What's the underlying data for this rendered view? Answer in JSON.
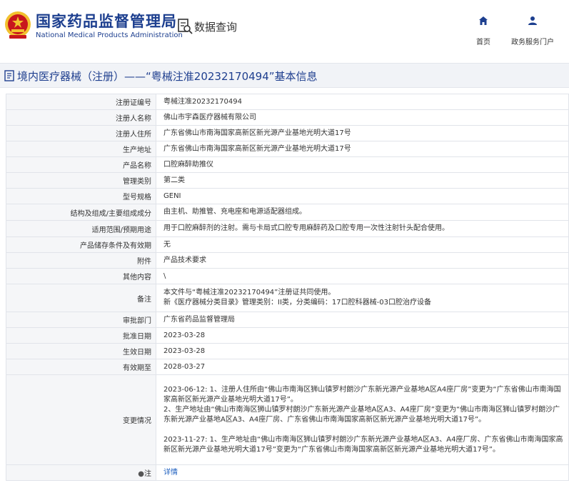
{
  "header": {
    "agency_name_cn": "国家药品监督管理局",
    "agency_name_en": "National Medical Products Administration",
    "database_title": "数据查询",
    "nav": [
      {
        "label": "首页",
        "icon": "home-icon"
      },
      {
        "label": "政务服务门户",
        "icon": "user-icon"
      }
    ]
  },
  "page": {
    "title": "境内医疗器械（注册）——“粤械注准20232170494”基本信息"
  },
  "fields": [
    {
      "label": "注册证编号",
      "value": "粤械注准20232170494"
    },
    {
      "label": "注册人名称",
      "value": "佛山市宇森医疗器械有限公司"
    },
    {
      "label": "注册人住所",
      "value": "广东省佛山市南海国家高新区新光源产业基地光明大道17号"
    },
    {
      "label": "生产地址",
      "value": "广东省佛山市南海国家高新区新光源产业基地光明大道17号"
    },
    {
      "label": "产品名称",
      "value": "口腔麻醉助推仪"
    },
    {
      "label": "管理类别",
      "value": "第二类"
    },
    {
      "label": "型号规格",
      "value": "GENI"
    },
    {
      "label": "结构及组成/主要组成成分",
      "value": "由主机、助推管、充电座和电源适配器组成。"
    },
    {
      "label": "适用范围/预期用途",
      "value": "用于口腔麻醉剂的注射。需与卡局式口腔专用麻醉药及口腔专用一次性注射针头配合使用。"
    },
    {
      "label": "产品储存条件及有效期",
      "value": "无"
    },
    {
      "label": "附件",
      "value": "产品技术要求"
    },
    {
      "label": "其他内容",
      "value": "\\"
    },
    {
      "label": "备注",
      "lines": [
        "本文件与“粤械注准20232170494”注册证共同使用。",
        "新《医疗器械分类目录》管理类别：II类，分类编码：17口腔科器械-03口腔治疗设备"
      ]
    },
    {
      "label": "审批部门",
      "value": "广东省药品监督管理局"
    },
    {
      "label": "批准日期",
      "value": "2023-03-28"
    },
    {
      "label": "生效日期",
      "value": "2023-03-28"
    },
    {
      "label": "有效期至",
      "value": "2028-03-27"
    },
    {
      "label": "变更情况",
      "lines": [
        "2023-06-12: 1、注册人住所由“佛山市南海区狮山镇罗村朗沙广东新光源产业基地A区A4座厂房”变更为“广东省佛山市南海国家高新区新光源产业基地光明大道17号”。",
        "2、生产地址由“佛山市南海区狮山镇罗村朗沙广东新光源产业基地A区A3、A4座厂房”变更为“佛山市南海区狮山镇罗村朗沙广东新光源产业基地A区A3、A4座厂房、广东省佛山市南海国家高新区新光源产业基地光明大道17号”。",
        "",
        "2023-11-27: 1、生产地址由“佛山市南海区狮山镇罗村朗沙广东新光源产业基地A区A3、A4座厂房、广东省佛山市南海国家高新区新光源产业基地光明大道17号”变更为“广东省佛山市南海国家高新区新光源产业基地光明大道17号”。"
      ]
    }
  ],
  "note_row": {
    "label": "注",
    "link": "详情"
  },
  "colors": {
    "brand_blue": "#1d3f8f",
    "emblem_red": "#c8161d",
    "emblem_gold": "#f2c12e",
    "link_blue": "#1d5fbf"
  }
}
